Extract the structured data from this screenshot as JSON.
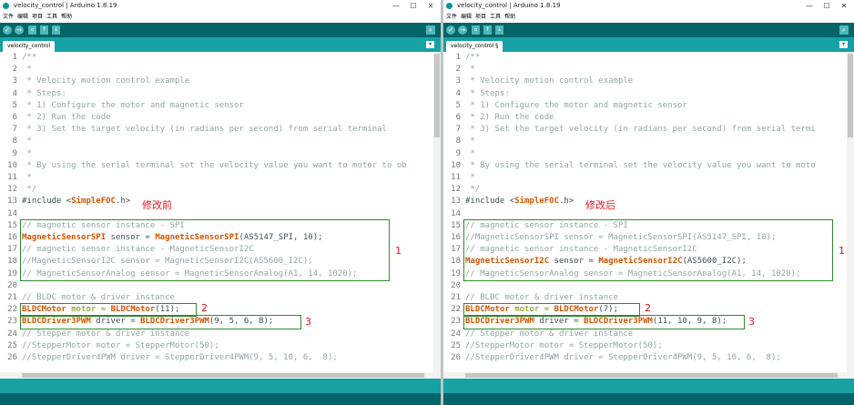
{
  "windows": [
    {
      "title": "velocity_control | Arduino 1.8.19",
      "menu": [
        "文件",
        "编辑",
        "项目",
        "工具",
        "帮助"
      ],
      "tab_label": "velocity_control",
      "annotation_label": "修改前",
      "callouts": [
        "1",
        "2",
        "3"
      ],
      "lines": [
        [
          {
            "t": "/**",
            "c": "cm"
          }
        ],
        [
          {
            "t": " *",
            "c": "cm"
          }
        ],
        [
          {
            "t": " * Velocity motion control example",
            "c": "cm"
          }
        ],
        [
          {
            "t": " * Steps:",
            "c": "cm"
          }
        ],
        [
          {
            "t": " * 1) Configure the motor and magnetic sensor",
            "c": "cm"
          }
        ],
        [
          {
            "t": " * 2) Run the code",
            "c": "cm"
          }
        ],
        [
          {
            "t": " * 3) Set the target velocity (in radians per second) from serial terminal",
            "c": "cm"
          }
        ],
        [
          {
            "t": " *",
            "c": "cm"
          }
        ],
        [
          {
            "t": " *",
            "c": "cm"
          }
        ],
        [
          {
            "t": " * By using the serial terminal set the velocity value you want to motor to ob",
            "c": "cm"
          }
        ],
        [
          {
            "t": " *",
            "c": "cm"
          }
        ],
        [
          {
            "t": " */",
            "c": "cm"
          }
        ],
        [
          {
            "t": "#include ",
            "c": "tx"
          },
          {
            "t": "<",
            "c": "tx"
          },
          {
            "t": "SimpleFOC",
            "c": "kw"
          },
          {
            "t": ".h>",
            "c": "tx"
          }
        ],
        [
          {
            "t": "",
            "c": "tx"
          }
        ],
        [
          {
            "t": "// magnetic sensor instance - SPI",
            "c": "cm"
          }
        ],
        [
          {
            "t": "MagneticSensorSPI",
            "c": "kw"
          },
          {
            "t": " sensor = ",
            "c": "tx"
          },
          {
            "t": "MagneticSensorSPI",
            "c": "kw"
          },
          {
            "t": "(AS5147_SPI, 10);",
            "c": "tx"
          }
        ],
        [
          {
            "t": "// magnetic sensor instance - MagneticSensorI2C",
            "c": "cm"
          }
        ],
        [
          {
            "t": "//MagneticSensorI2C sensor = MagneticSensorI2C(AS5600_I2C);",
            "c": "cm"
          }
        ],
        [
          {
            "t": "// MagneticSensorAnalog sensor = MagneticSensorAnalog(A1, 14, 1020);",
            "c": "cm"
          }
        ],
        [
          {
            "t": "",
            "c": "tx"
          }
        ],
        [
          {
            "t": "// BLDC motor & driver instance",
            "c": "cm"
          }
        ],
        [
          {
            "t": "BLDCMotor",
            "c": "kw"
          },
          {
            "t": " motor = ",
            "c": "kw2"
          },
          {
            "t": "BLDCMotor",
            "c": "kw"
          },
          {
            "t": "(11);",
            "c": "tx"
          }
        ],
        [
          {
            "t": "BLDCDriver3PWM",
            "c": "kw"
          },
          {
            "t": " driver = ",
            "c": "tx"
          },
          {
            "t": "BLDCDriver3PWM",
            "c": "kw"
          },
          {
            "t": "(9, 5, 6, 8);",
            "c": "tx"
          }
        ],
        [
          {
            "t": "// Stepper motor & driver instance",
            "c": "cm"
          }
        ],
        [
          {
            "t": "//StepperMotor motor = StepperMotor(50);",
            "c": "cm"
          }
        ],
        [
          {
            "t": "//StepperDriver4PWM driver = StepperDriver4PWM(9, 5, 10, 6,  8);",
            "c": "cm"
          }
        ]
      ]
    },
    {
      "title": "velocity_control | Arduino 1.8.19",
      "menu": [
        "文件",
        "编辑",
        "项目",
        "工具",
        "帮助"
      ],
      "tab_label": "velocity_control §",
      "annotation_label": "修改后",
      "callouts": [
        "1",
        "2",
        "3"
      ],
      "lines": [
        [
          {
            "t": "/**",
            "c": "cm"
          }
        ],
        [
          {
            "t": " *",
            "c": "cm"
          }
        ],
        [
          {
            "t": " * Velocity motion control example",
            "c": "cm"
          }
        ],
        [
          {
            "t": " * Steps:",
            "c": "cm"
          }
        ],
        [
          {
            "t": " * 1) Configure the motor and magnetic sensor",
            "c": "cm"
          }
        ],
        [
          {
            "t": " * 2) Run the code",
            "c": "cm"
          }
        ],
        [
          {
            "t": " * 3) Set the target velocity (in radians per second) from serial termi",
            "c": "cm"
          }
        ],
        [
          {
            "t": " *",
            "c": "cm"
          }
        ],
        [
          {
            "t": " *",
            "c": "cm"
          }
        ],
        [
          {
            "t": " * By using the serial terminal set the velocity value you want to moto",
            "c": "cm"
          }
        ],
        [
          {
            "t": " *",
            "c": "cm"
          }
        ],
        [
          {
            "t": " */",
            "c": "cm"
          }
        ],
        [
          {
            "t": "#include ",
            "c": "tx"
          },
          {
            "t": "<",
            "c": "tx"
          },
          {
            "t": "SimpleFOC",
            "c": "kw"
          },
          {
            "t": ".h>",
            "c": "tx"
          }
        ],
        [
          {
            "t": "",
            "c": "tx"
          }
        ],
        [
          {
            "t": "// magnetic sensor instance - SPI",
            "c": "cm"
          }
        ],
        [
          {
            "t": "//MagneticSensorSPI sensor = MagneticSensorSPI(AS5147_SPI, 10);",
            "c": "cm"
          }
        ],
        [
          {
            "t": "// magnetic sensor instance - MagneticSensorI2C",
            "c": "cm"
          }
        ],
        [
          {
            "t": "MagneticSensorI2C",
            "c": "kw"
          },
          {
            "t": " sensor = ",
            "c": "tx"
          },
          {
            "t": "MagneticSensorI2C",
            "c": "kw"
          },
          {
            "t": "(AS5600_I2C);",
            "c": "tx"
          }
        ],
        [
          {
            "t": "// MagneticSensorAnalog sensor = MagneticSensorAnalog(A1, 14, 1020);",
            "c": "cm"
          }
        ],
        [
          {
            "t": "",
            "c": "tx"
          }
        ],
        [
          {
            "t": "// BLDC motor & driver instance",
            "c": "cm"
          }
        ],
        [
          {
            "t": "BLDCMotor",
            "c": "kw"
          },
          {
            "t": " motor = ",
            "c": "kw2"
          },
          {
            "t": "BLDCMotor",
            "c": "kw"
          },
          {
            "t": "(7);",
            "c": "tx"
          }
        ],
        [
          {
            "t": "BLDCDriver3PWM",
            "c": "kw"
          },
          {
            "t": " driver = ",
            "c": "tx"
          },
          {
            "t": "BLDCDriver3PWM",
            "c": "kw"
          },
          {
            "t": "(11, 10, 9, 8);",
            "c": "tx"
          }
        ],
        [
          {
            "t": "// Stepper motor & driver instance",
            "c": "cm"
          }
        ],
        [
          {
            "t": "//StepperMotor motor = StepperMotor(50);",
            "c": "cm"
          }
        ],
        [
          {
            "t": "//StepperDriver4PWM driver = StepperDriver4PWM(9, 5, 10, 6,  8);",
            "c": "cm"
          }
        ]
      ]
    }
  ],
  "line_numbers": [
    "1",
    "2",
    "3",
    "4",
    "5",
    "6",
    "7",
    "8",
    "9",
    "10",
    "11",
    "12",
    "13",
    "14",
    "15",
    "16",
    "17",
    "18",
    "19",
    "20",
    "21",
    "22",
    "23",
    "24",
    "25",
    "26"
  ],
  "toolbar_icons": [
    "verify-icon",
    "upload-icon",
    "new-icon",
    "open-icon",
    "save-icon",
    "serial-monitor-icon"
  ],
  "window_controls": [
    "—",
    "☐",
    "✕"
  ],
  "toolbar_glyphs": {
    "verify": "✓",
    "upload": "→",
    "new": "▫",
    "open": "↑",
    "save": "↓",
    "serial": "⌕"
  },
  "tab_menu_glyph": "▾",
  "colors": {
    "toolbar": "#006468",
    "tabbar": "#17a1a5",
    "keyword": "#d35400",
    "comment": "#95a5a6",
    "highlight_box": "#2e8b2e",
    "annotation": "#e0191e"
  }
}
